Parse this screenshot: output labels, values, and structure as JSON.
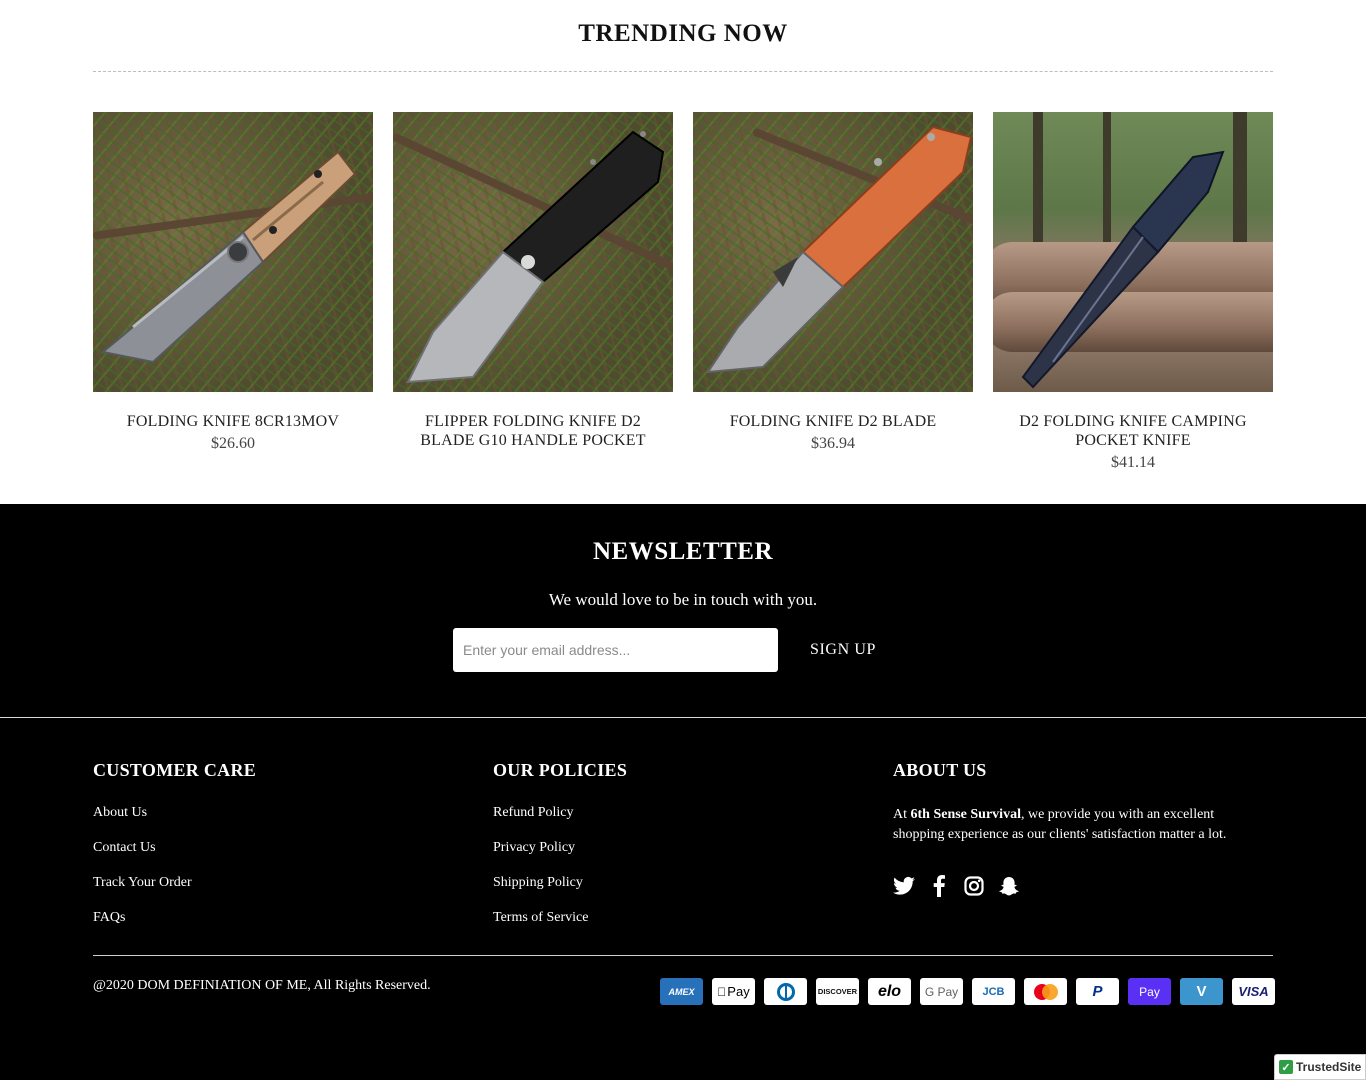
{
  "trending": {
    "title": "TRENDING NOW",
    "products": [
      {
        "name": "FOLDING KNIFE 8CR13MOV",
        "price": "$26.60",
        "image_icon": "knife-wood-handle-image"
      },
      {
        "name": "FLIPPER FOLDING KNIFE D2 BLADE G10 HANDLE POCKET",
        "price": "",
        "image_icon": "knife-black-handle-image"
      },
      {
        "name": "FOLDING KNIFE D2 BLADE",
        "price": "$36.94",
        "image_icon": "knife-orange-handle-image"
      },
      {
        "name": "D2 FOLDING KNIFE CAMPING POCKET KNIFE",
        "price": "$41.14",
        "image_icon": "knife-blue-handle-image"
      }
    ]
  },
  "newsletter": {
    "title": "NEWSLETTER",
    "subtitle": "We would love to be in touch with you.",
    "email_placeholder": "Enter your email address...",
    "email_value": "",
    "signup_label": "SIGN UP"
  },
  "footer": {
    "customer_care": {
      "title": "CUSTOMER CARE",
      "links": [
        "About Us",
        "Contact Us",
        "Track Your Order",
        "FAQs"
      ]
    },
    "policies": {
      "title": "OUR POLICIES",
      "links": [
        "Refund Policy",
        "Privacy Policy",
        "Shipping Policy",
        "Terms of Service"
      ]
    },
    "about": {
      "title": "ABOUT US",
      "text_prefix": "At ",
      "brand": "6th Sense Survival",
      "text_suffix": ", we provide you with an excellent shopping experience as our clients' satisfaction matter a lot.",
      "social_icons": [
        "twitter-icon",
        "facebook-icon",
        "instagram-icon",
        "snapchat-icon"
      ]
    },
    "copyright": "@2020 DOM DEFINIATION OF ME, All Rights Reserved.",
    "payment_methods": [
      {
        "label": "AMEX",
        "icon": "amex-icon",
        "bg": "#2671b9",
        "fg": "#ffffff"
      },
      {
        "label": "Pay",
        "icon": "apple-pay-icon",
        "bg": "#ffffff",
        "fg": "#000000"
      },
      {
        "label": "",
        "icon": "diners-club-icon",
        "bg": "#ffffff",
        "fg": "#0069aa"
      },
      {
        "label": "DISCOVER",
        "icon": "discover-icon",
        "bg": "#ffffff",
        "fg": "#111111"
      },
      {
        "label": "elo",
        "icon": "elo-icon",
        "bg": "#ffffff",
        "fg": "#000000"
      },
      {
        "label": "G Pay",
        "icon": "google-pay-icon",
        "bg": "#ffffff",
        "fg": "#5f6368"
      },
      {
        "label": "JCB",
        "icon": "jcb-icon",
        "bg": "#ffffff",
        "fg": "#1a6bb5"
      },
      {
        "label": "",
        "icon": "mastercard-icon",
        "bg": "#ffffff",
        "fg": "#eb001b"
      },
      {
        "label": "P",
        "icon": "paypal-icon",
        "bg": "#ffffff",
        "fg": "#003087"
      },
      {
        "label": "Pay",
        "icon": "shop-pay-icon",
        "bg": "#5a31f4",
        "fg": "#ffffff"
      },
      {
        "label": "V",
        "icon": "venmo-icon",
        "bg": "#3d95ce",
        "fg": "#ffffff"
      },
      {
        "label": "VISA",
        "icon": "visa-icon",
        "bg": "#ffffff",
        "fg": "#1a1f71"
      }
    ],
    "trusted_badge": "TrustedSite"
  },
  "colors": {
    "footer_bg": "#000000",
    "page_bg": "#ffffff",
    "knife_handles": [
      "#c9a07a",
      "#1f1f1f",
      "#d9703e",
      "#2a3550"
    ]
  }
}
